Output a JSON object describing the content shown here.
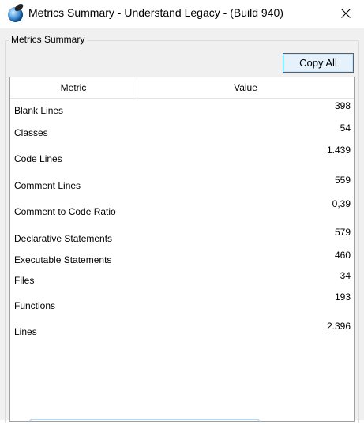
{
  "window": {
    "title": "Metrics Summary - Understand Legacy - (Build 940)",
    "icon": "understand-app-icon",
    "close_icon": "close-icon"
  },
  "group": {
    "legend": "Metrics Summary"
  },
  "toolbar": {
    "copy_all_label": "Copy All"
  },
  "table": {
    "columns": [
      "Metric",
      "Value"
    ],
    "rows": [
      {
        "metric": "Blank Lines",
        "value": "398"
      },
      {
        "metric": "Classes",
        "value": "54"
      },
      {
        "metric": "Code Lines",
        "value": "1.439"
      },
      {
        "metric": "Comment Lines",
        "value": "559"
      },
      {
        "metric": "Comment to Code Ratio",
        "value": "0,39"
      },
      {
        "metric": "Declarative Statements",
        "value": "579"
      },
      {
        "metric": "Executable Statements",
        "value": "460"
      },
      {
        "metric": "Files",
        "value": "34"
      },
      {
        "metric": "Functions",
        "value": "193"
      },
      {
        "metric": "Lines",
        "value": "2.396"
      }
    ]
  },
  "colors": {
    "accent": "#0078d7",
    "window_bg": "#f0f0f0",
    "table_bg": "#ffffff"
  }
}
